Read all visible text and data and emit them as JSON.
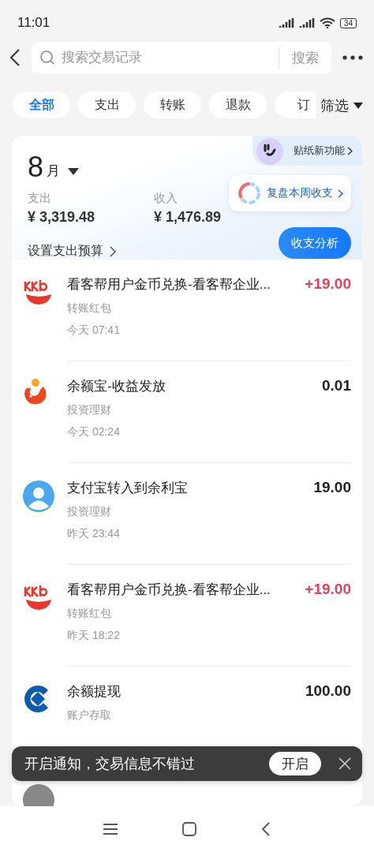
{
  "status_bar": {
    "time": "11:01",
    "battery": "34"
  },
  "header": {
    "search": {
      "placeholder": "搜索交易记录"
    },
    "search_button": "搜索"
  },
  "filters": [
    {
      "label": "全部",
      "selected": true
    },
    {
      "label": "支出",
      "selected": false
    },
    {
      "label": "转账",
      "selected": false
    },
    {
      "label": "退款",
      "selected": false
    },
    {
      "label": "订",
      "selected": false
    }
  ],
  "filter_button": "筛选",
  "summary": {
    "month": "8",
    "month_unit": "月",
    "expense_label": "支出",
    "expense": "¥ 3,319.48",
    "income_label": "收入",
    "income": "¥ 1,476.89",
    "budget_link": "设置支出预算",
    "sticker_badge": "贴纸新功能",
    "review_popup": "复盘本周收支",
    "analysis_button": "收支分析"
  },
  "transactions": [
    {
      "kind": "kkb",
      "title": "看客帮用户金币兑换-看客帮企业...",
      "category": "转账红包",
      "time": "今天 07:41",
      "amount": "+19.00",
      "income": true
    },
    {
      "kind": "whale",
      "title": "余额宝-收益发放",
      "category": "投资理财",
      "time": "今天 02:24",
      "amount": "0.01",
      "income": false
    },
    {
      "kind": "person",
      "title": "支付宝转入到余利宝",
      "category": "投资理财",
      "time": "昨天 23:44",
      "amount": "19.00",
      "income": false
    },
    {
      "kind": "kkb",
      "title": "看客帮用户金币兑换-看客帮企业...",
      "category": "转账红包",
      "time": "昨天 18:22",
      "amount": "+19.00",
      "income": true
    },
    {
      "kind": "bank",
      "title": "余额提现",
      "category": "账户存取",
      "amount": "100.00",
      "income": false
    }
  ],
  "toast": {
    "message": "开启通知，交易信息不错过",
    "button": "开启"
  }
}
